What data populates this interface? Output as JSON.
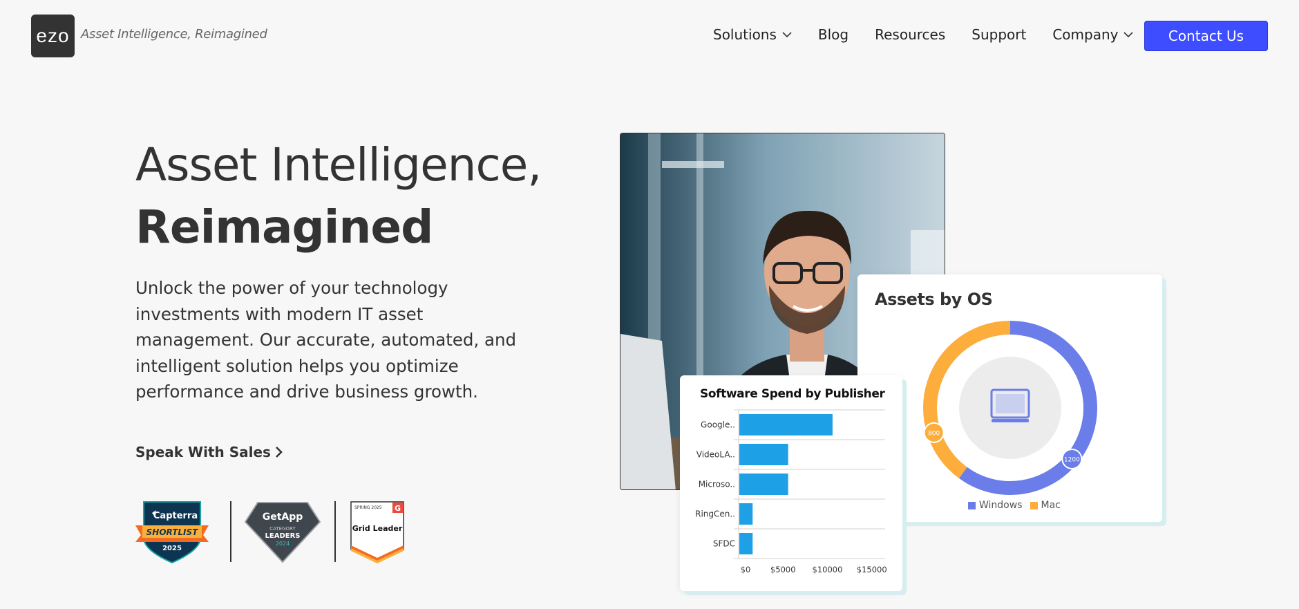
{
  "header": {
    "logo_text": "ezo",
    "tagline": "Asset Intelligence, Reimagined",
    "nav": [
      {
        "label": "Solutions",
        "has_dropdown": true
      },
      {
        "label": "Blog",
        "has_dropdown": false
      },
      {
        "label": "Resources",
        "has_dropdown": false
      },
      {
        "label": "Support",
        "has_dropdown": false
      },
      {
        "label": "Company",
        "has_dropdown": true
      }
    ],
    "contact_label": "Contact Us",
    "accent": "#3d4dff"
  },
  "hero": {
    "title_line1": "Asset Intelligence,",
    "title_line2": "Reimagined",
    "subtitle": "Unlock the power of your technology investments with modern IT asset management. Our accurate, automated, and intelligent solution helps you optimize performance and drive business growth.",
    "cta_label": "Speak With Sales"
  },
  "badges": {
    "capterra": {
      "brand": "Capterra",
      "ribbon": "SHORTLIST",
      "year": "2025"
    },
    "getapp": {
      "brand": "GetApp",
      "line1": "CATEGORY",
      "line2": "LEADERS",
      "year": "2024"
    },
    "g2": {
      "season": "SPRING 2025",
      "label": "Grid Leader",
      "logo": "G"
    }
  },
  "os_card": {
    "title": "Assets by OS",
    "icon": "laptop-icon",
    "legend": [
      {
        "label": "Windows",
        "color": "#6a7de8"
      },
      {
        "label": "Mac",
        "color": "#fdad3b"
      }
    ]
  },
  "spend_card": {
    "title": "Software Spend by Publisher"
  },
  "chart_data": [
    {
      "type": "pie",
      "title": "Assets by OS",
      "categories": [
        "Windows",
        "Mac"
      ],
      "values": [
        1200,
        800
      ],
      "data_labels": [
        "1200",
        "800"
      ],
      "colors": [
        "#6a7de8",
        "#fdad3b"
      ],
      "legend": "bottom"
    },
    {
      "type": "bar",
      "orientation": "horizontal",
      "title": "Software Spend by Publisher",
      "categories": [
        "Google..",
        "VideoLA..",
        "Microso..",
        "RingCen..",
        "SFDC"
      ],
      "values": [
        10500,
        5500,
        5500,
        1500,
        1500
      ],
      "xticks": [
        "$0",
        "$5000",
        "$10000",
        "$15000"
      ],
      "xlim": [
        0,
        16500
      ],
      "bar_color": "#1ea0e6",
      "grid": true
    }
  ]
}
